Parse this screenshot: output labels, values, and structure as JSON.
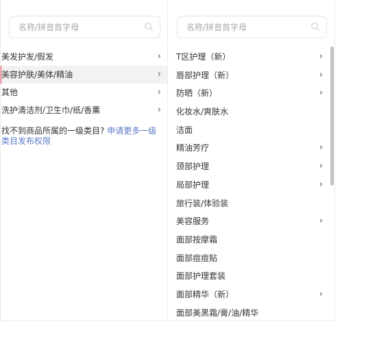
{
  "left_panel": {
    "search_placeholder": "名称/拼音首字母",
    "items": [
      {
        "label": "美发护发/假发",
        "has_children": true,
        "active": false
      },
      {
        "label": "美容护肤/美体/精油",
        "has_children": true,
        "active": true
      },
      {
        "label": "其他",
        "has_children": true,
        "active": false
      },
      {
        "label": "洗护清洁剂/卫生巾/纸/香薰",
        "has_children": true,
        "active": false
      }
    ],
    "notice_text": "找不到商品所属的一级类目?",
    "notice_link": "申请更多一级类目发布权限"
  },
  "right_panel": {
    "search_placeholder": "名称/拼音首字母",
    "items": [
      {
        "label": "T区护理（新）",
        "has_children": true
      },
      {
        "label": "唇部护理（新）",
        "has_children": true
      },
      {
        "label": "防晒（新）",
        "has_children": true
      },
      {
        "label": "化妆水/爽肤水",
        "has_children": false
      },
      {
        "label": "洁面",
        "has_children": false
      },
      {
        "label": "精油芳疗",
        "has_children": true
      },
      {
        "label": "颈部护理",
        "has_children": true
      },
      {
        "label": "局部护理",
        "has_children": true
      },
      {
        "label": "旅行装/体验装",
        "has_children": false
      },
      {
        "label": "美容服务",
        "has_children": true
      },
      {
        "label": "面部按摩霜",
        "has_children": false
      },
      {
        "label": "面部痘痘贴",
        "has_children": false
      },
      {
        "label": "面部护理套装",
        "has_children": false
      },
      {
        "label": "面部精华（新）",
        "has_children": true
      },
      {
        "label": "面部美黑霜/膏/油/精华",
        "has_children": false
      }
    ]
  },
  "chevron_glyph": "›",
  "colors": {
    "active_marker": "#e8364e",
    "active_background": "#f2f2f2",
    "link": "#5b7ac7",
    "placeholder": "#a8a8a8"
  },
  "icons": {
    "search": "search-icon",
    "chevron": "chevron-right-icon"
  }
}
